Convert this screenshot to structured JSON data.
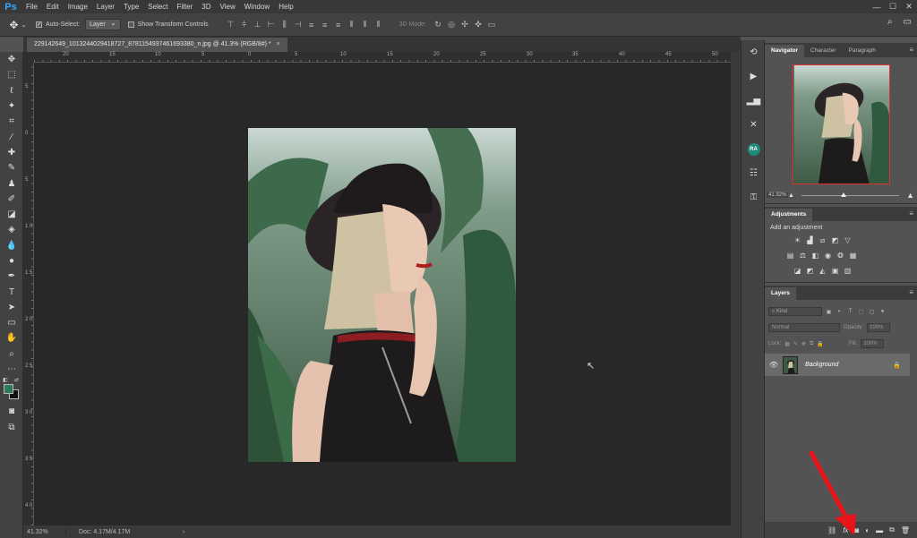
{
  "app": {
    "logo": "Ps"
  },
  "menu": [
    "File",
    "Edit",
    "Image",
    "Layer",
    "Type",
    "Select",
    "Filter",
    "3D",
    "View",
    "Window",
    "Help"
  ],
  "window_controls": {
    "minimize": "—",
    "maximize": "☐",
    "close": "✕"
  },
  "options": {
    "auto_select_label": "Auto-Select:",
    "auto_select_value": "Layer",
    "show_transform_label": "Show Transform Controls",
    "mode_3d_label": "3D Mode:"
  },
  "document": {
    "tab_title": "229142649_1013244029418727_8781154937461693380_n.jpg @ 41.3% (RGB/8#) *",
    "close": "×"
  },
  "ruler": {
    "top": [
      "20",
      "15",
      "10",
      "5",
      "0",
      "5",
      "10",
      "15",
      "20",
      "25",
      "30",
      "35",
      "40",
      "45",
      "50"
    ],
    "left": [
      "5",
      "0",
      "5",
      "1 0",
      "1 5",
      "2 0",
      "2 5",
      "3 0",
      "3 5",
      "4 0"
    ]
  },
  "status": {
    "zoom": "41.32%",
    "doc": "Doc: 4.17M/4.17M",
    "arrow": "›"
  },
  "navigator": {
    "tabs": [
      "Navigator",
      "Character",
      "Paragraph"
    ],
    "zoom": "41.32%"
  },
  "adjustments": {
    "title": "Adjustments",
    "subtitle": "Add an adjustment"
  },
  "layers": {
    "title": "Layers",
    "kind": "Kind",
    "blend": "Normal",
    "opacity_label": "Opacity:",
    "opacity": "100%",
    "lock_label": "Lock:",
    "fill_label": "Fill:",
    "fill": "100%",
    "items": [
      {
        "name": "Background"
      }
    ],
    "bottom_fx": "fx"
  },
  "colors": {
    "accent": "#31a8ff",
    "foreground": "#2e7a5a",
    "background": "#111111",
    "highlight_arrow": "#e8141a"
  }
}
